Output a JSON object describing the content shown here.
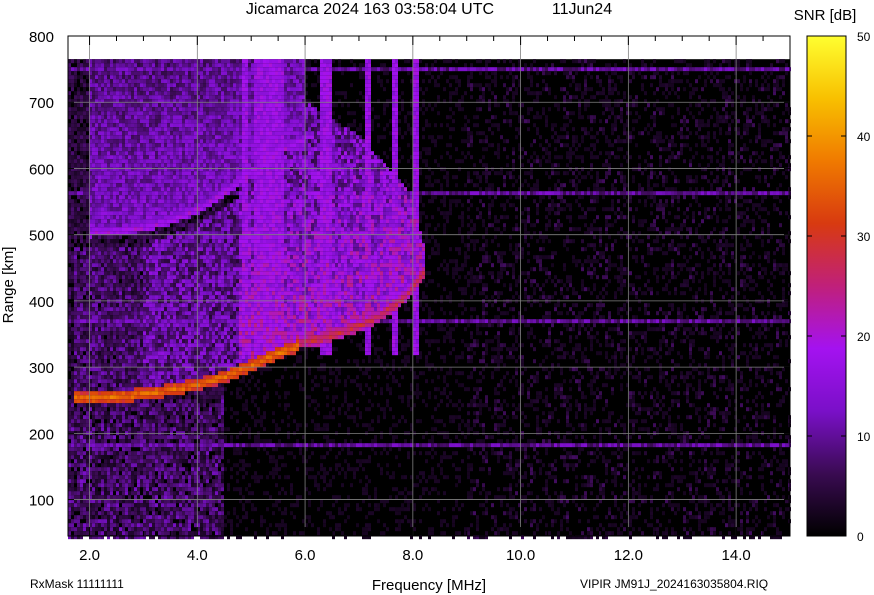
{
  "chart_data": {
    "type": "heatmap",
    "title": "Jicamarca 2024 163 03:58:04 UTC",
    "date": "11Jun24",
    "xlabel": "Frequency [MHz]",
    "ylabel": "Range [km]",
    "colorbar_label": "SNR [dB]",
    "xlim": [
      1.6,
      15.0
    ],
    "ylim": [
      45,
      800
    ],
    "data_ymax": 765,
    "x_ticks": [
      "2.0",
      "4.0",
      "6.0",
      "8.0",
      "10.0",
      "12.0",
      "14.0"
    ],
    "x_tick_values": [
      2,
      4,
      6,
      8,
      10,
      12,
      14
    ],
    "x_minor_step": 0.5,
    "y_ticks": [
      "100",
      "200",
      "300",
      "400",
      "500",
      "600",
      "700",
      "800"
    ],
    "y_tick_values": [
      100,
      200,
      300,
      400,
      500,
      600,
      700,
      800
    ],
    "colorbar_ticks": [
      "0",
      "10",
      "20",
      "30",
      "40",
      "50"
    ],
    "colorbar_tick_values": [
      0,
      10,
      20,
      30,
      40,
      50
    ],
    "colorbar_range": [
      0,
      50
    ],
    "colormap": [
      "#000000",
      "#3a0b52",
      "#7a10c8",
      "#a412f0",
      "#c0207a",
      "#d83a10",
      "#f07a00",
      "#f8c000",
      "#ffff30"
    ],
    "grid": true,
    "traces": [
      {
        "name": "",
        "description_free": true,
        "x": [
          1.7,
          2.0,
          2.5,
          3.0,
          3.5,
          4.0,
          4.5,
          5.0,
          5.3,
          5.6,
          5.9
        ],
        "range": [
          250,
          250,
          252,
          256,
          262,
          270,
          282,
          298,
          310,
          320,
          330
        ],
        "peak_snr": 34
      },
      {
        "name": "",
        "x": [
          5.9,
          6.3,
          6.7,
          7.1,
          7.4,
          7.7,
          8.0,
          8.2
        ],
        "range": [
          333,
          340,
          350,
          362,
          375,
          392,
          415,
          440
        ],
        "peak_snr": 26
      },
      {
        "name": "",
        "x": [
          2.0,
          2.5,
          3.0,
          3.5,
          4.0,
          4.5,
          5.0,
          5.5,
          5.9
        ],
        "range": [
          500,
          502,
          508,
          518,
          535,
          560,
          592,
          622,
          638
        ],
        "peak_snr": 18
      }
    ]
  },
  "footer": {
    "rxmask": "RxMask 11111111",
    "file": "VIPIR  JM91J_2024163035804.RIQ"
  }
}
